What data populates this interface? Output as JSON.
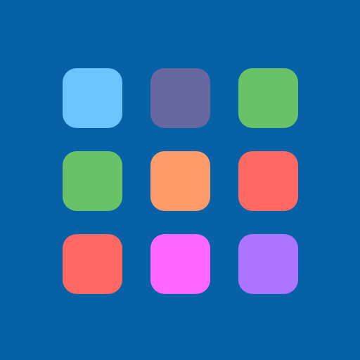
{
  "background_color": "#0761a6",
  "tiles": [
    {
      "color": "#6cc4ff"
    },
    {
      "color": "#67689f"
    },
    {
      "color": "#69c267"
    },
    {
      "color": "#69c267"
    },
    {
      "color": "#fe9b6b"
    },
    {
      "color": "#fe6862"
    },
    {
      "color": "#fe6862"
    },
    {
      "color": "#fe66ff"
    },
    {
      "color": "#ad75ff"
    }
  ]
}
